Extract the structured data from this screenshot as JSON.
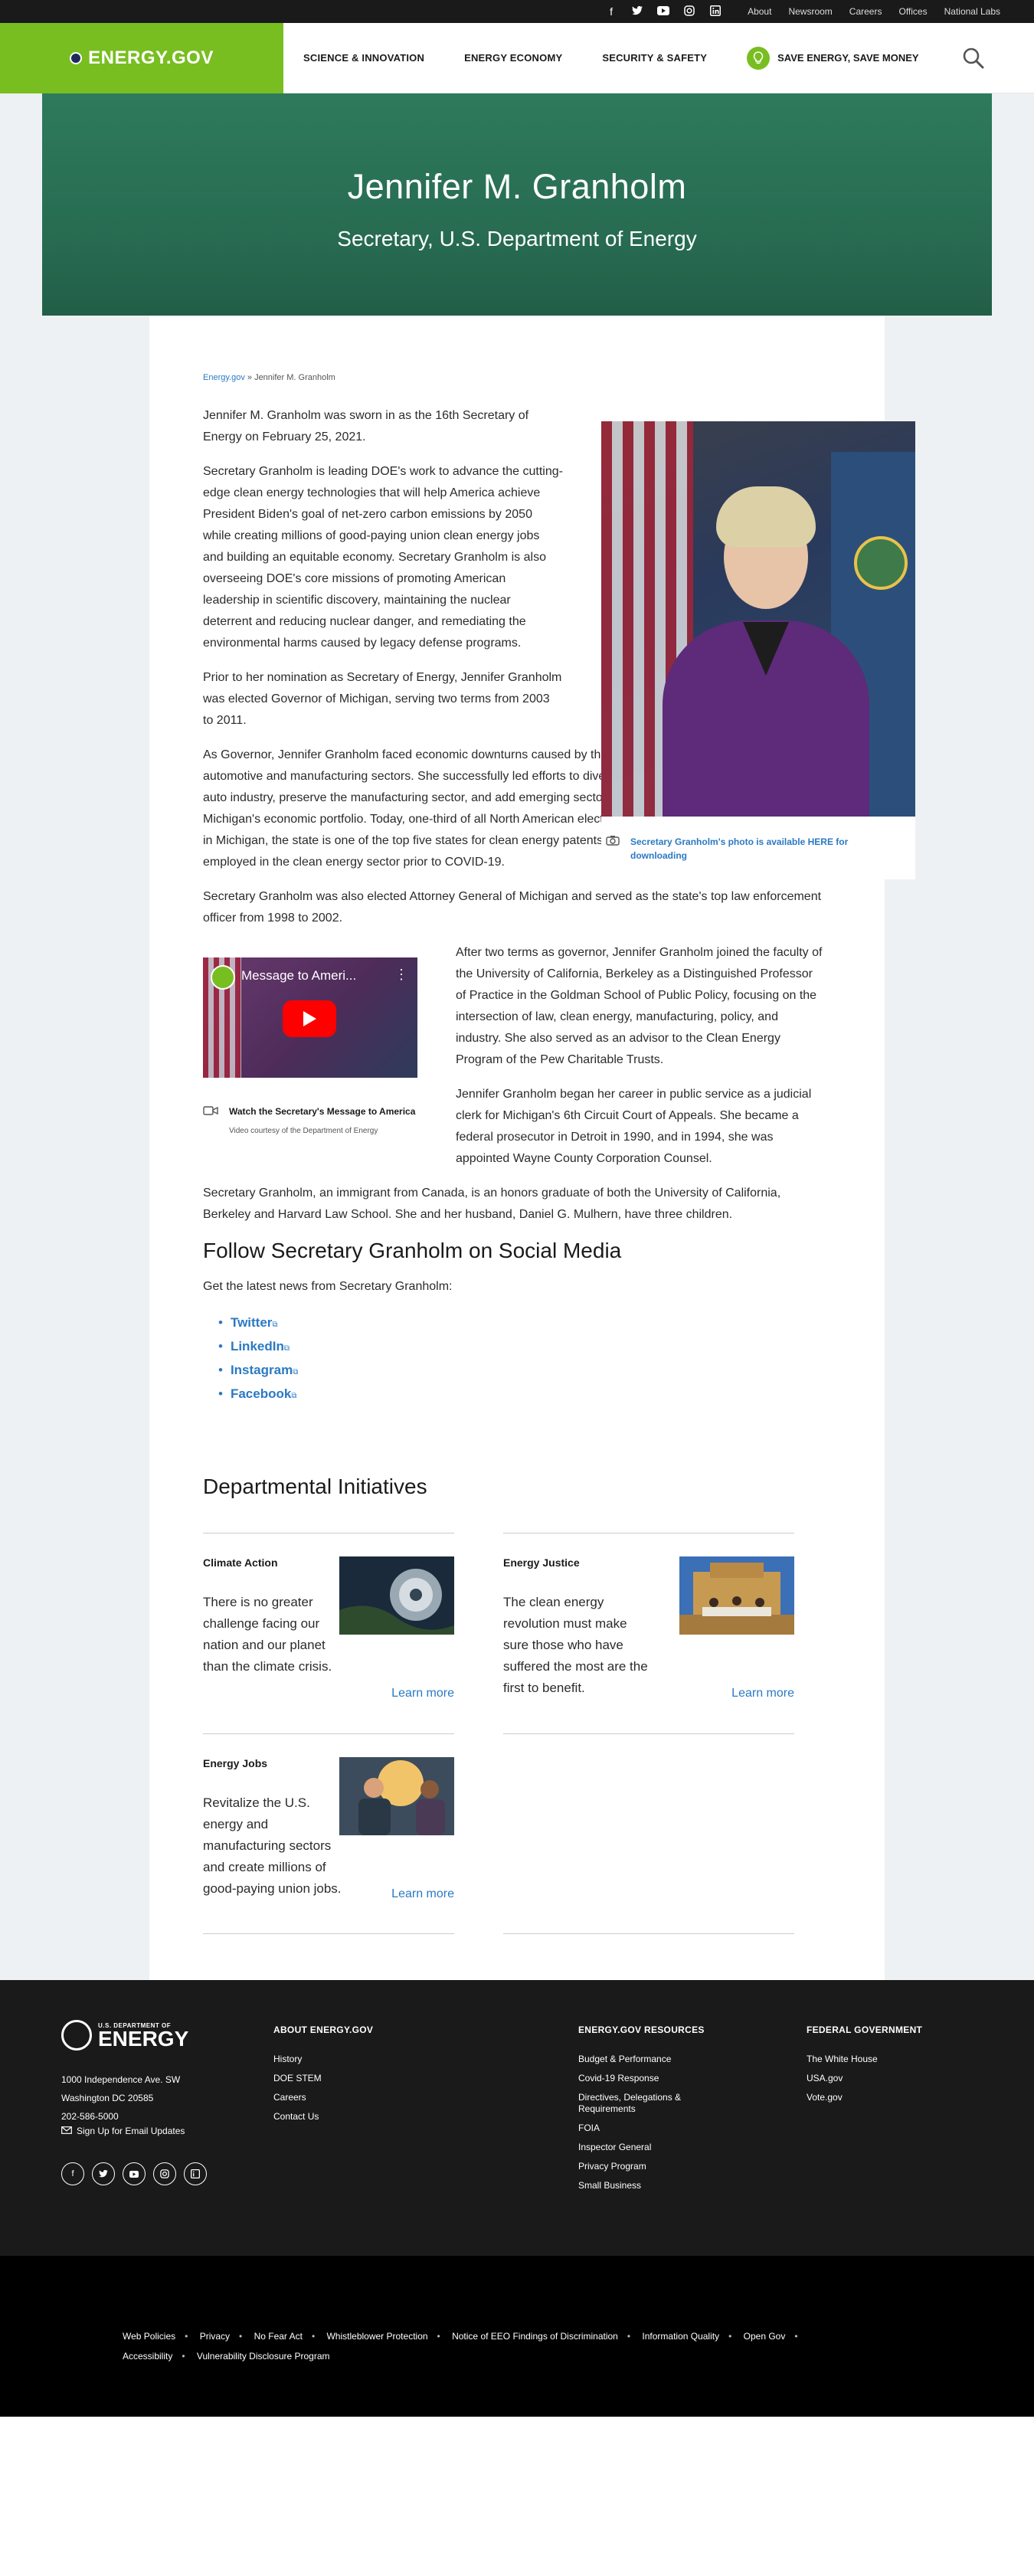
{
  "topbar": {
    "social_icons": [
      "facebook-icon",
      "twitter-icon",
      "youtube-icon",
      "instagram-icon",
      "linkedin-icon"
    ],
    "links": [
      "About",
      "Newsroom",
      "Careers",
      "Offices",
      "National Labs"
    ]
  },
  "nav": {
    "logo": "ENERGY.GOV",
    "items": [
      "SCIENCE & INNOVATION",
      "ENERGY ECONOMY",
      "SECURITY & SAFETY"
    ],
    "save_energy": "SAVE ENERGY, SAVE MONEY"
  },
  "hero": {
    "name": "Jennifer M. Granholm",
    "title": "Secretary, U.S. Department of Energy"
  },
  "breadcrumb": {
    "home": "Energy.gov",
    "sep": " » ",
    "current": "Jennifer M. Granholm"
  },
  "bio": {
    "p1": "Jennifer M. Granholm was sworn in as the 16th Secretary of Energy on February 25, 2021.",
    "p2": "Secretary Granholm is leading DOE's work to advance the cutting-edge clean energy technologies that will help America achieve President Biden's goal of net-zero carbon emissions by 2050 while creating millions of good-paying union clean energy jobs and building an equitable economy. Secretary Granholm is also overseeing DOE's core missions of promoting American leadership in scientific discovery, maintaining the nuclear deterrent and reducing nuclear danger, and remediating the environmental harms caused by legacy defense programs.",
    "p3": "Prior to her nomination as Secretary of Energy, Jennifer Granholm was elected Governor of Michigan, serving two terms from 2003 to 2011.",
    "p4": "As Governor, Jennifer Granholm faced economic downturns caused by the Great Recession and meltdown in the automotive and manufacturing sectors. She successfully led efforts to diversify the state's economy, strengthen its auto industry, preserve the manufacturing sector, and add emerging sectors — such as clean energy — to Michigan's economic portfolio. Today, one-third of all North American electric vehicle battery production takes place in Michigan, the state is one of the top five states for clean energy patents, and 126,000 Michiganders were employed in the clean energy sector prior to COVID-19.",
    "p5": "Secretary Granholm was also elected Attorney General of Michigan and served as the state's top law enforcement officer from 1998 to 2002.",
    "p6": "After two terms as governor, Jennifer Granholm joined the faculty of the University of California, Berkeley as a Distinguished Professor of Practice in the Goldman School of Public Policy, focusing on the intersection of law, clean energy, manufacturing, policy, and industry. She also served as an advisor to the Clean Energy Program of the Pew Charitable Trusts.",
    "p7": "Jennifer Granholm began her career in public service as a judicial clerk for Michigan's 6th Circuit Court of Appeals. She became a federal prosecutor in Detroit in 1990, and in 1994, she was appointed Wayne County Corporation Counsel.",
    "p8": "Secretary Granholm, an immigrant from Canada, is an honors graduate of both the University of California, Berkeley and Harvard Law School. She and her husband, Daniel G. Mulhern, have three children."
  },
  "photo": {
    "caption": "Secretary Granholm's photo is available HERE for downloading"
  },
  "video": {
    "thumb_title": "Message to Ameri...",
    "caption_title": "Watch the Secretary's Message to America",
    "caption_sub": "Video courtesy of the Department of Energy"
  },
  "follow": {
    "heading": "Follow Secretary Granholm on Social Media",
    "intro": "Get the latest news from Secretary Granholm:",
    "links": [
      "Twitter",
      "LinkedIn",
      "Instagram",
      "Facebook"
    ]
  },
  "initiatives": {
    "heading": "Departmental Initiatives",
    "cards": [
      {
        "title": "Climate Action",
        "desc": "There is no greater challenge facing our nation and our planet than the climate crisis.",
        "more": "Learn more"
      },
      {
        "title": "Energy Justice",
        "desc": "The clean energy revolution must make sure those who have suffered the most are the first to benefit.",
        "more": "Learn more"
      },
      {
        "title": "Energy Jobs",
        "desc": "Revitalize the U.S. energy and manufacturing sectors and create millions of good-paying union jobs.",
        "more": "Learn more"
      }
    ]
  },
  "footer": {
    "logo_small": "U.S. DEPARTMENT OF",
    "logo_big": "ENERGY",
    "address": [
      "1000 Independence Ave. SW",
      "Washington DC 20585",
      "202-586-5000"
    ],
    "signup": "Sign Up for Email Updates",
    "col1_head": "ABOUT ENERGY.GOV",
    "col1": [
      "History",
      "DOE STEM",
      "Careers",
      "Contact Us"
    ],
    "col2_head": "ENERGY.GOV RESOURCES",
    "col2": [
      "Budget & Performance",
      "Covid-19 Response",
      "Directives, Delegations & Requirements",
      "FOIA",
      "Inspector General",
      "Privacy Program",
      "Small Business"
    ],
    "col3_head": "FEDERAL GOVERNMENT",
    "col3": [
      "The White House",
      "USA.gov",
      "Vote.gov"
    ]
  },
  "subfooter": {
    "links": [
      "Web Policies",
      "Privacy",
      "No Fear Act",
      "Whistleblower Protection",
      "Notice of EEO Findings of Discrimination",
      "Information Quality",
      "Open Gov",
      "Accessibility",
      "Vulnerability Disclosure Program"
    ]
  }
}
